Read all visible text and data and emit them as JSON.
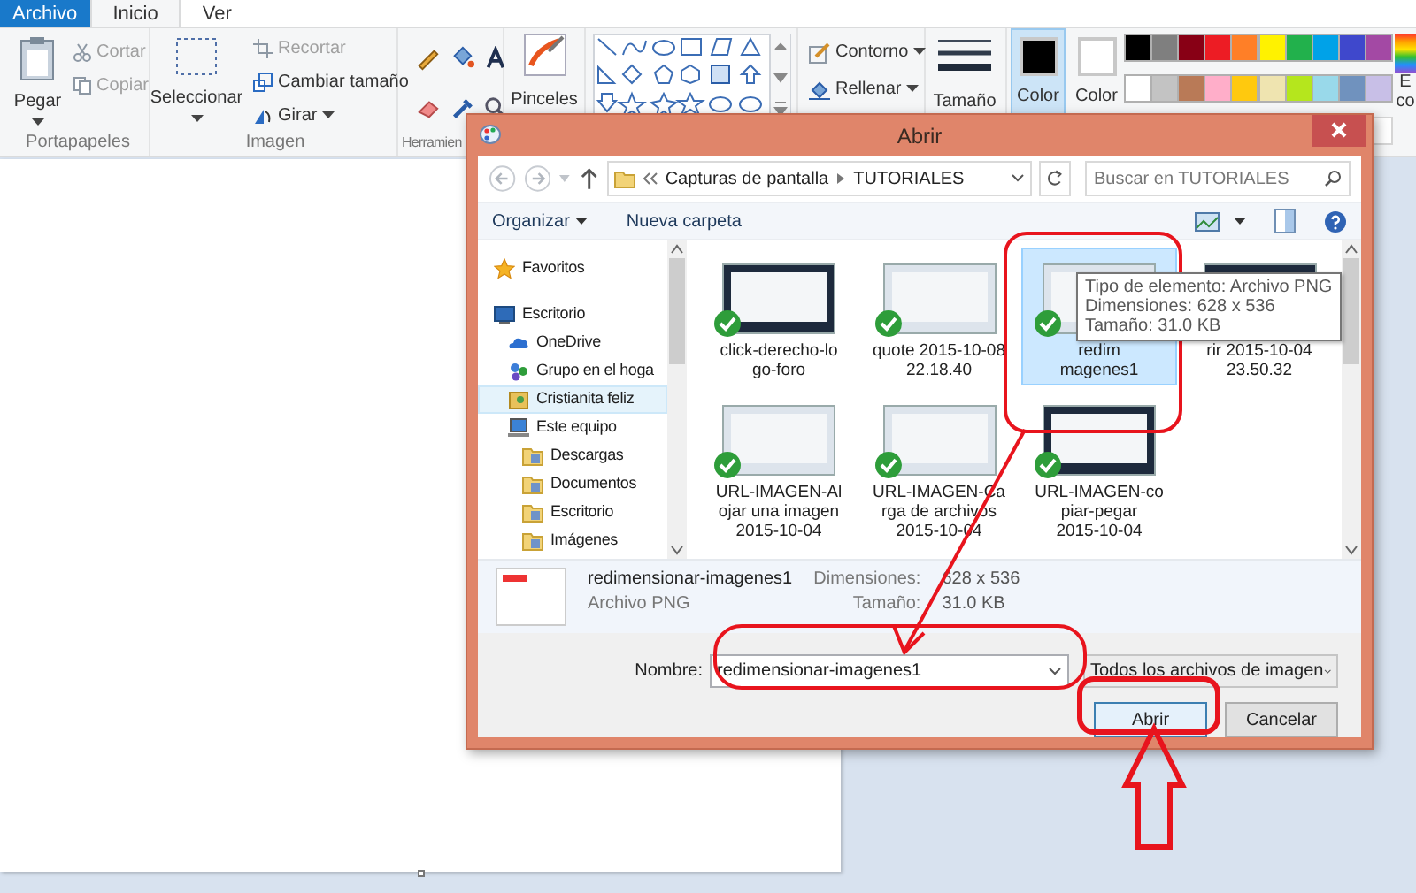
{
  "ribbon_tabs": [
    {
      "label": "Archivo",
      "kind": "file",
      "selected": false
    },
    {
      "label": "Inicio",
      "kind": "tab",
      "selected": true
    },
    {
      "label": "Ver",
      "kind": "tab",
      "selected": false
    }
  ],
  "clipboard": {
    "paste": "Pegar",
    "cut": {
      "label": "Cortar",
      "disabled": true
    },
    "copy": {
      "label": "Copiar",
      "disabled": true
    },
    "group_label": "Portapapeles"
  },
  "image": {
    "select": "Seleccionar",
    "crop": {
      "label": "Recortar",
      "disabled": true
    },
    "resize": {
      "label": "Cambiar tamaño",
      "disabled": false
    },
    "rotate": {
      "label": "Girar",
      "disabled": false
    },
    "group_label": "Imagen"
  },
  "tools": {
    "group_label": "Herramien"
  },
  "brushes": {
    "label": "Pinceles"
  },
  "shape_options": {
    "outline": "Contorno",
    "fill": "Rellenar"
  },
  "size": {
    "label": "Tamaño"
  },
  "color_slots": [
    {
      "label": "Color",
      "color": "#000000",
      "selected": true
    },
    {
      "label": "Color",
      "color": "#ffffff",
      "selected": false
    }
  ],
  "palette": [
    {
      "color": "#000000"
    },
    {
      "color": "#7f7f7f"
    },
    {
      "color": "#880015"
    },
    {
      "color": "#ed1c24"
    },
    {
      "color": "#ff7f27"
    },
    {
      "color": "#fff200"
    },
    {
      "color": "#22b14c"
    },
    {
      "color": "#00a2e8"
    },
    {
      "color": "#3f48cc"
    },
    {
      "color": "#a349a4"
    },
    {
      "color": "#ffffff"
    },
    {
      "color": "#c3c3c3"
    },
    {
      "color": "#b97a57"
    },
    {
      "color": "#ffaec9"
    },
    {
      "color": "#ffc90e"
    },
    {
      "color": "#efe4b0"
    },
    {
      "color": "#b5e61d"
    },
    {
      "color": "#99d9ea"
    },
    {
      "color": "#7092be"
    },
    {
      "color": "#c8bfe7"
    }
  ],
  "edit_colors_label": [
    "E",
    "co"
  ],
  "dialog": {
    "title": "Abrir",
    "breadcrumb": [
      "Capturas de pantalla",
      "TUTORIALES"
    ],
    "search": {
      "placeholder": "Buscar en TUTORIALES"
    },
    "commands": [
      {
        "label": "Organizar",
        "dropdown": true
      },
      {
        "label": "Nueva carpeta",
        "dropdown": false
      }
    ],
    "nav": [
      {
        "label": "Favoritos",
        "kind": "favorites",
        "selected": false
      },
      {
        "label": "Escritorio",
        "kind": "desktop",
        "selected": false,
        "children": [
          {
            "label": "OneDrive",
            "kind": "onedrive",
            "selected": false
          },
          {
            "label": "Grupo en el hoga",
            "kind": "homegroup",
            "selected": false
          },
          {
            "label": "Cristianita feliz",
            "kind": "user",
            "selected": true
          },
          {
            "label": "Este equipo",
            "kind": "computer",
            "selected": false,
            "children": [
              {
                "label": "Descargas",
                "kind": "folder",
                "selected": false
              },
              {
                "label": "Documentos",
                "kind": "folder",
                "selected": false
              },
              {
                "label": "Escritorio",
                "kind": "folder",
                "selected": false
              },
              {
                "label": "Imágenes",
                "kind": "folder",
                "selected": false
              }
            ]
          }
        ]
      }
    ],
    "files": [
      {
        "lines": [
          "click-derecho-lo",
          "go-foro"
        ],
        "checked": true,
        "selected": false
      },
      {
        "lines": [
          "quote 2015-10-08",
          "22.18.40"
        ],
        "checked": true,
        "selected": false
      },
      {
        "lines": [
          "redim",
          "magenes1"
        ],
        "checked": true,
        "selected": true
      },
      {
        "lines": [
          "rir 2015-10-04",
          "23.50.32"
        ],
        "selected": false
      },
      {
        "lines": [
          "URL-IMAGEN-Al",
          "ojar una imagen",
          "2015-10-04"
        ],
        "checked": true,
        "selected": false
      },
      {
        "lines": [
          "URL-IMAGEN-Ca",
          "rga de archivos",
          "2015-10-04"
        ],
        "checked": true,
        "selected": false
      },
      {
        "lines": [
          "URL-IMAGEN-co",
          "piar-pegar",
          "2015-10-04"
        ],
        "checked": true,
        "selected": false
      }
    ],
    "tooltip": [
      "Tipo de elemento: Archivo PNG",
      "Dimensiones: 628 x 536",
      "Tamaño: 31.0 KB"
    ],
    "details": {
      "name": "redimensionar-imagenes1",
      "type": "Archivo PNG",
      "dimensions_label": "Dimensiones:",
      "dimensions": "628 x 536",
      "size_label": "Tamaño:",
      "size": "31.0 KB"
    },
    "file_name_label": "Nombre:",
    "file_name": "redimensionar-imagenes1",
    "file_type": "Todos los archivos de imagen",
    "buttons": [
      {
        "label": "Abrir",
        "default": true
      },
      {
        "label": "Cancelar",
        "default": false
      }
    ]
  }
}
